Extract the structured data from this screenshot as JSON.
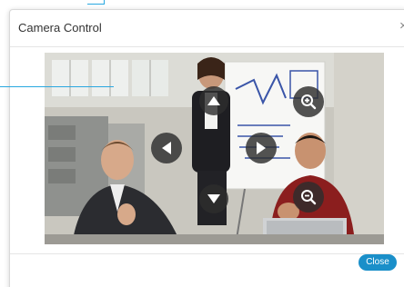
{
  "dialog": {
    "title": "Camera Control",
    "close_glyph": "×",
    "close_button_label": "Close"
  },
  "controls": {
    "pan_up": "arrow-up-icon",
    "pan_down": "arrow-down-icon",
    "pan_left": "arrow-left-icon",
    "pan_right": "arrow-right-icon",
    "zoom_in": "zoom-in-icon",
    "zoom_out": "zoom-out-icon"
  },
  "colors": {
    "accent": "#1a8fc9",
    "callout": "#29a8e0",
    "control_bg": "#2d2d2d"
  }
}
